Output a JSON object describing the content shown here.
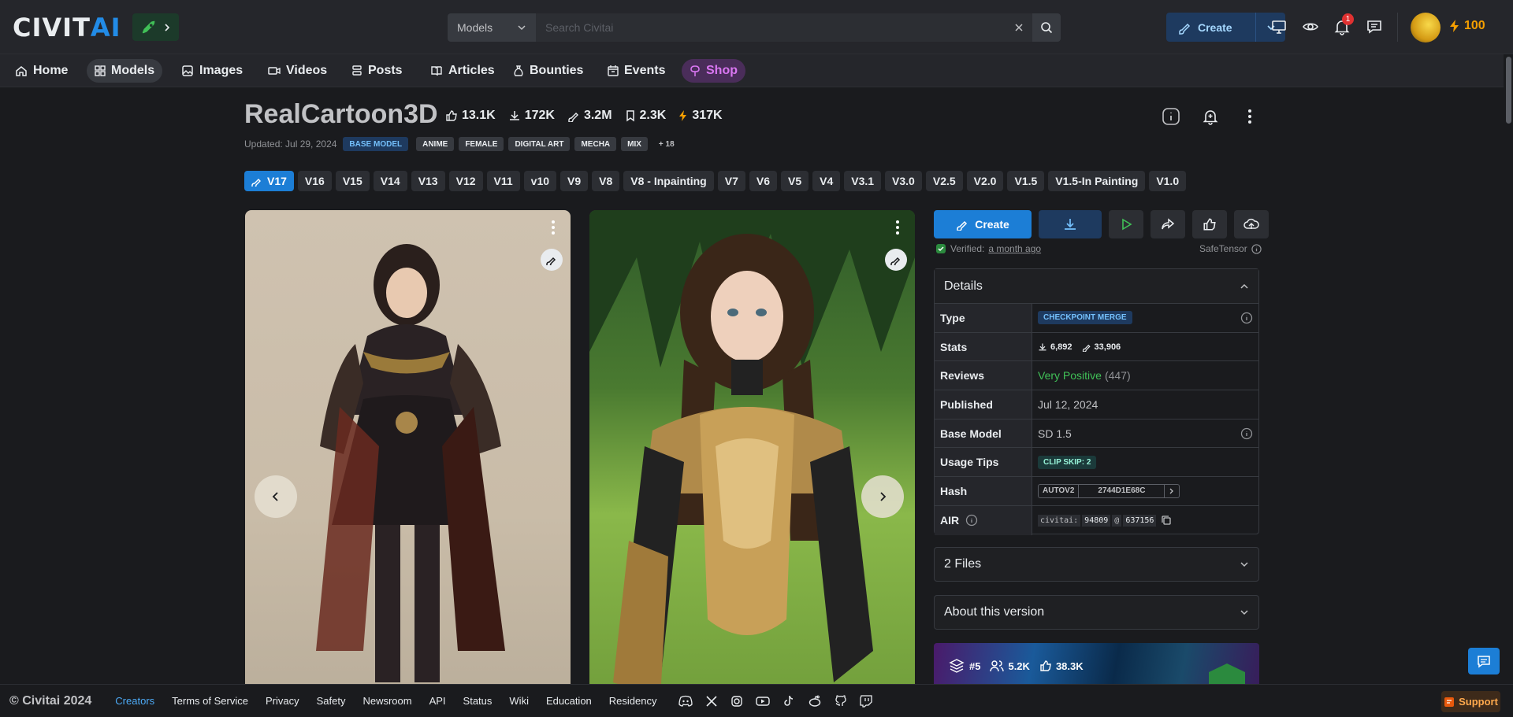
{
  "header": {
    "logo_main": "CIVIT",
    "logo_accent": "AI",
    "search_category": "Models",
    "search_placeholder": "Search Civitai",
    "create_label": "Create",
    "notification_count": "1",
    "buzz_amount": "100"
  },
  "nav": {
    "items": [
      {
        "label": "Home",
        "icon": "home-icon"
      },
      {
        "label": "Models",
        "icon": "grid-icon"
      },
      {
        "label": "Images",
        "icon": "image-icon"
      },
      {
        "label": "Videos",
        "icon": "video-icon"
      },
      {
        "label": "Posts",
        "icon": "posts-icon"
      },
      {
        "label": "Articles",
        "icon": "book-icon"
      },
      {
        "label": "Bounties",
        "icon": "moneybag-icon"
      },
      {
        "label": "Events",
        "icon": "calendar-icon"
      },
      {
        "label": "Shop",
        "icon": "shop-icon"
      }
    ],
    "active": "Models"
  },
  "model": {
    "title": "RealCartoon3D",
    "stats": {
      "likes": "13.1K",
      "downloads": "172K",
      "generations": "3.2M",
      "collected": "2.3K",
      "buzz": "317K"
    },
    "updated": "Updated: Jul 29, 2024",
    "base_tag": "BASE MODEL",
    "tags": [
      "ANIME",
      "FEMALE",
      "DIGITAL ART",
      "MECHA",
      "MIX"
    ],
    "more_tags": "+ 18",
    "versions": [
      "V17",
      "V16",
      "V15",
      "V14",
      "V13",
      "V12",
      "V11",
      "v10",
      "V9",
      "V8",
      "V8 - Inpainting",
      "V7",
      "V6",
      "V5",
      "V4",
      "V3.1",
      "V3.0",
      "V2.5",
      "V2.0",
      "V1.5",
      "V1.5-In Painting",
      "V1.0"
    ],
    "active_version": "V17"
  },
  "sidebar": {
    "create_label": "Create",
    "verified_label": "Verified:",
    "verified_time": "a month ago",
    "safetensor": "SafeTensor",
    "details_title": "Details",
    "rows": {
      "type_key": "Type",
      "type_val": "CHECKPOINT MERGE",
      "stats_key": "Stats",
      "stats_downloads": "6,892",
      "stats_generations": "33,906",
      "reviews_key": "Reviews",
      "reviews_rating": "Very Positive",
      "reviews_count": "(447)",
      "published_key": "Published",
      "published_val": "Jul 12, 2024",
      "base_key": "Base Model",
      "base_val": "SD 1.5",
      "tips_key": "Usage Tips",
      "tips_val": "CLIP SKIP: 2",
      "hash_key": "Hash",
      "hash_type": "AUTOV2",
      "hash_val": "2744D1E68C",
      "air_key": "AIR",
      "air_prefix": "civitai:",
      "air_model": "94809",
      "air_at": "@",
      "air_version": "637156"
    },
    "files_label": "2 Files",
    "about_label": "About this version",
    "promo": {
      "rank": "#5",
      "followers": "5.2K",
      "likes": "38.3K"
    }
  },
  "footer": {
    "copyright": "© Civitai 2024",
    "links": [
      "Creators",
      "Terms of Service",
      "Privacy",
      "Safety",
      "Newsroom",
      "API",
      "Status",
      "Wiki",
      "Education",
      "Residency"
    ],
    "support": "Support"
  },
  "colors": {
    "accent": "#1c7ed6",
    "background": "#1a1b1e",
    "positive": "#40c057",
    "buzz": "#f59f00"
  }
}
